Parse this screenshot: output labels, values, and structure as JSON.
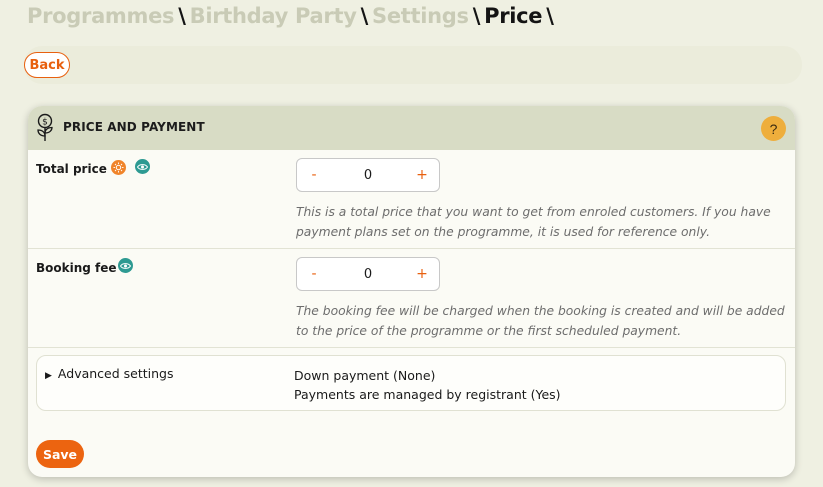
{
  "breadcrumb": {
    "items": [
      "Programmes",
      "Birthday Party",
      "Settings",
      "Price"
    ],
    "separator": "\\"
  },
  "topbar": {
    "back_label": "Back"
  },
  "card": {
    "title": "PRICE AND PAYMENT",
    "help_label": "?",
    "icon": "money-plant-icon"
  },
  "total_price": {
    "label": "Total price",
    "value": "0",
    "minus": "-",
    "plus": "+",
    "help": "This is a total price that you want to get from enroled customers. If you have payment plans set on the programme, it is used for reference only."
  },
  "booking_fee": {
    "label": "Booking fee",
    "value": "0",
    "minus": "-",
    "plus": "+",
    "help": "The booking fee will be charged when the booking is created and will be added to the price of the programme or the first scheduled payment."
  },
  "advanced": {
    "toggle_label": "Advanced settings",
    "summary_1": "Down payment (None)",
    "summary_2": "Payments are managed by registrant (Yes)"
  },
  "actions": {
    "save_label": "Save"
  },
  "colors": {
    "accent": "#ec6410",
    "header_bg": "#d8dcc5",
    "help_badge": "#eeae3c",
    "eye_badge": "#2e9a92",
    "sun_badge": "#f0842a"
  }
}
